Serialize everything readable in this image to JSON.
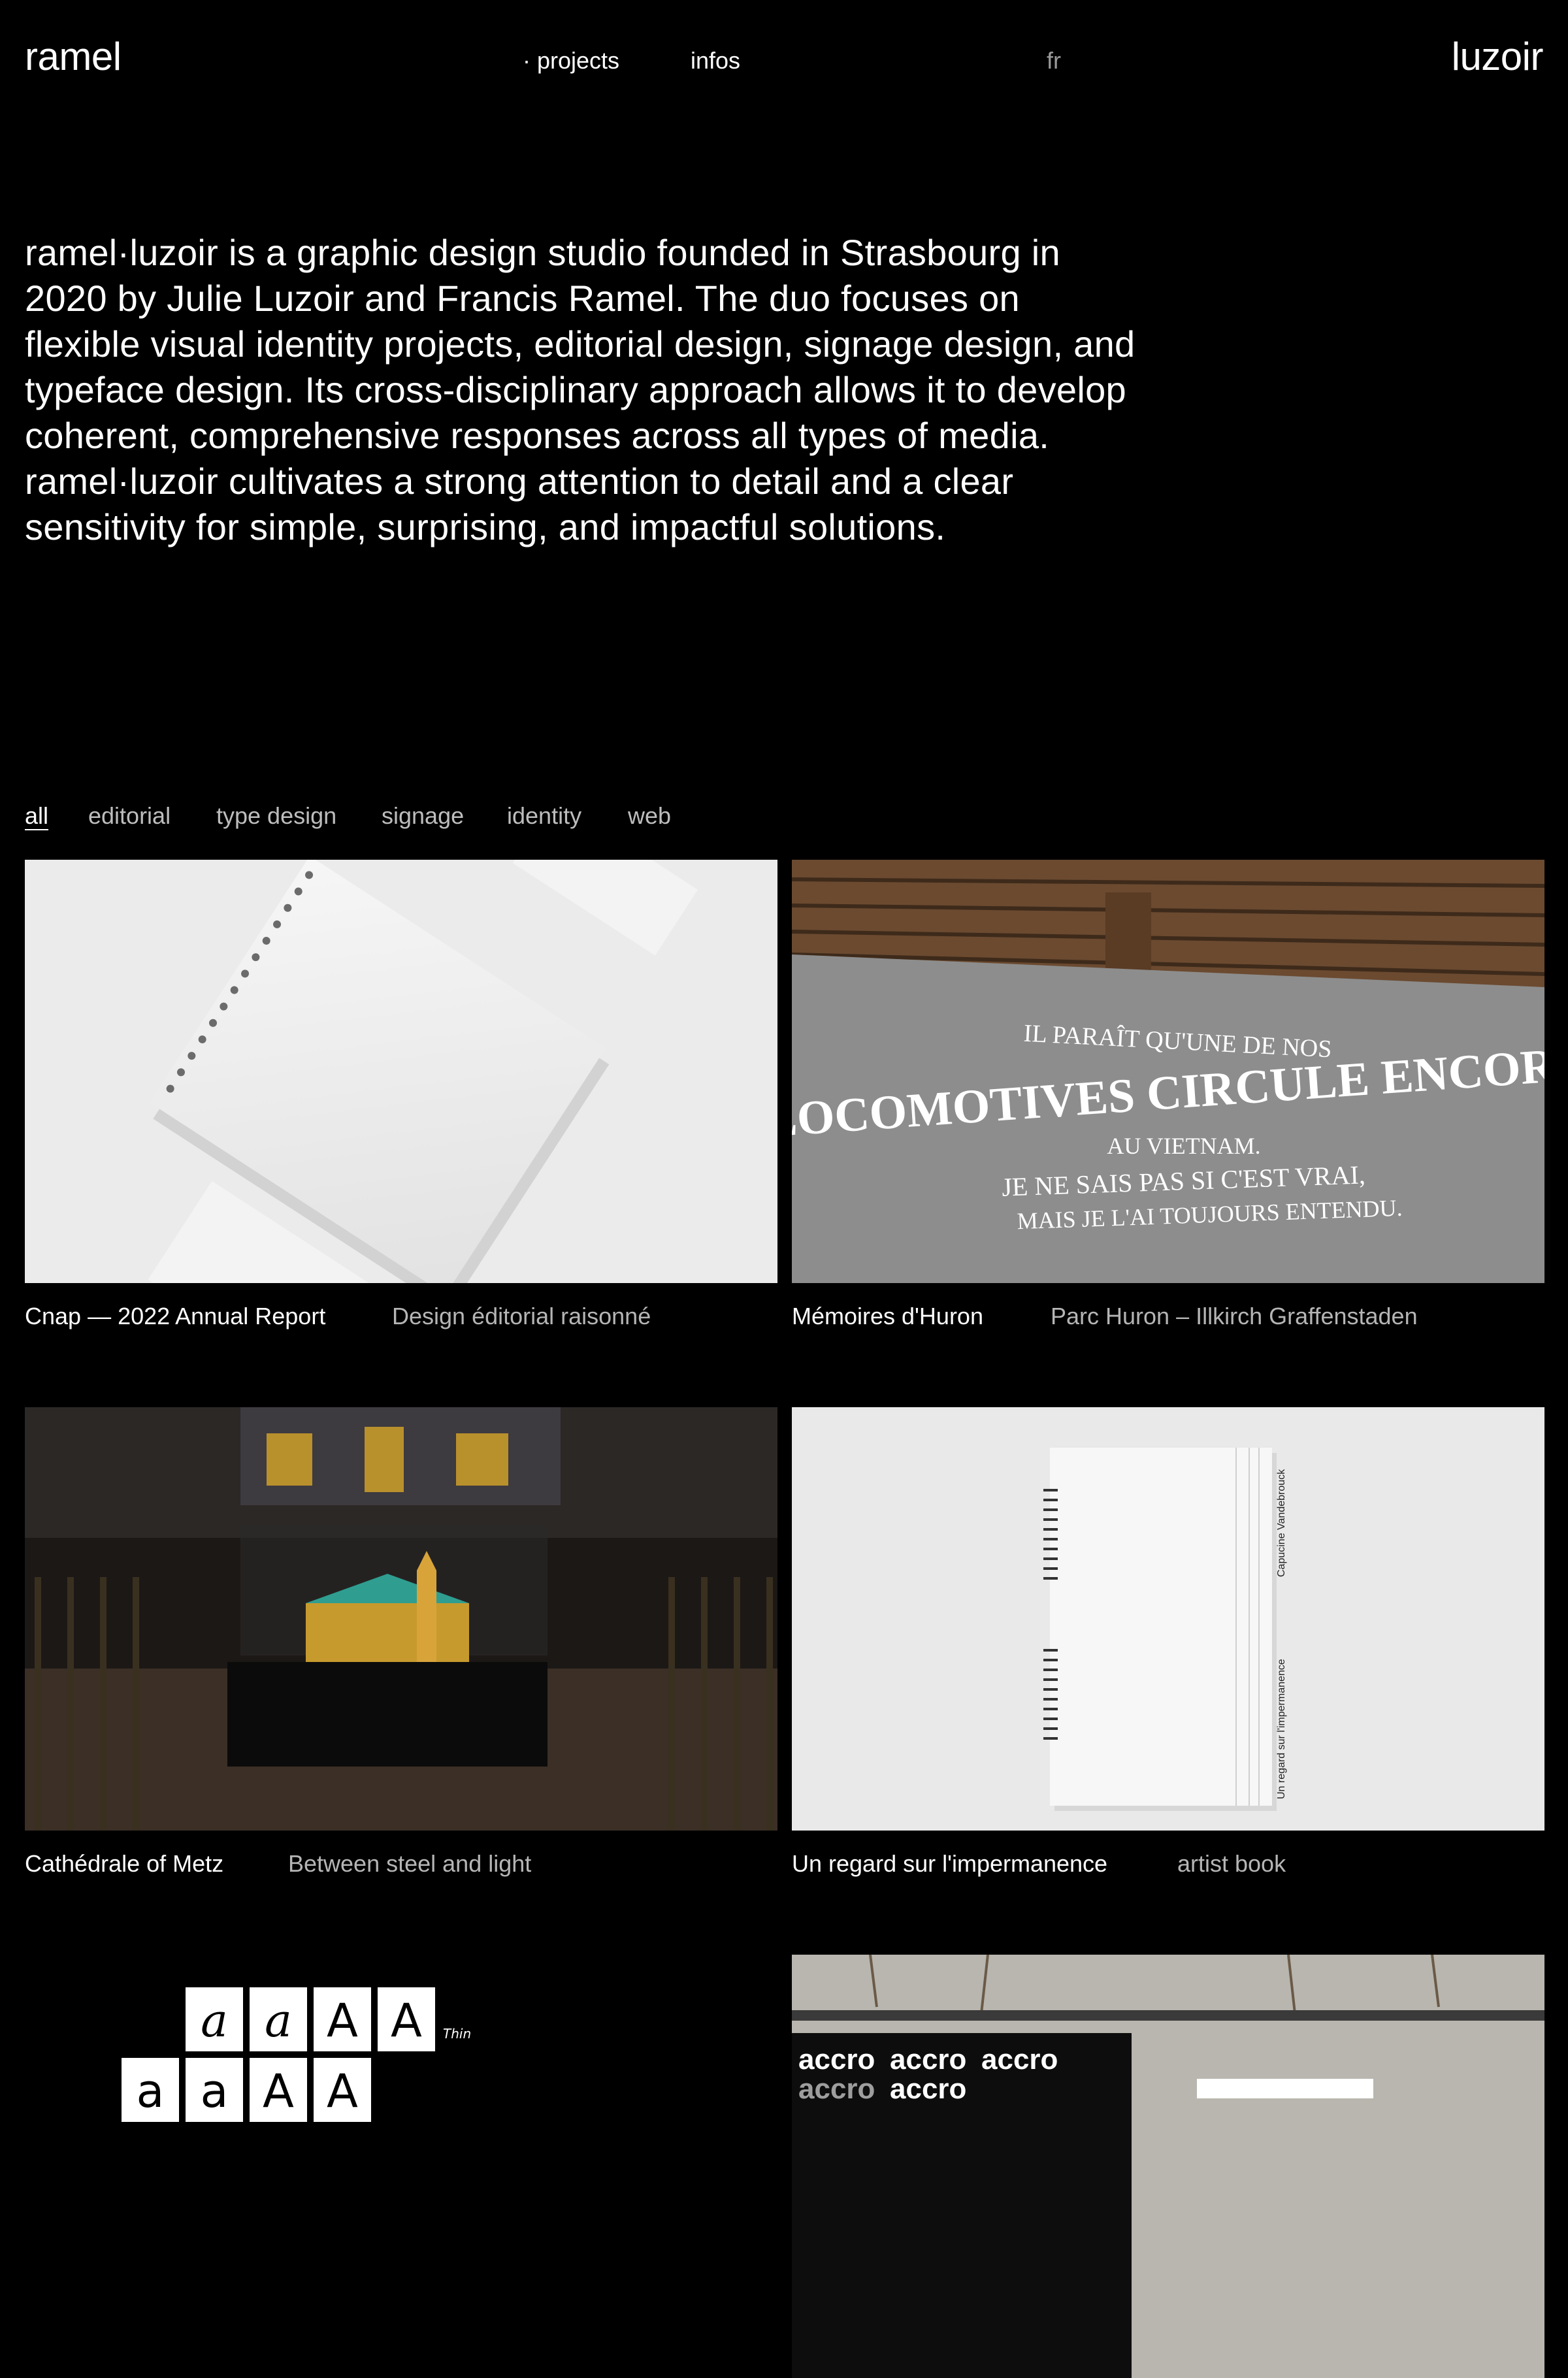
{
  "header": {
    "logo_left": "ramel",
    "logo_right": "luzoir",
    "nav": {
      "projects": "· projects",
      "infos": "infos",
      "lang": "fr"
    }
  },
  "intro": "ramel·luzoir is a graphic design studio founded in Strasbourg in 2020 by Julie Luzoir and Francis Ramel. The duo focuses on flexible visual identity projects, editorial design, signage design, and typeface design. Its cross-disciplinary approach allows it to develop coherent, comprehensive responses across all types of media. ramel·luzoir cultivates a strong attention to detail and a clear sensitivity for simple, surprising, and impactful solutions.",
  "filters": [
    {
      "label": "all",
      "active": true
    },
    {
      "label": "editorial",
      "active": false
    },
    {
      "label": "type design",
      "active": false
    },
    {
      "label": "signage",
      "active": false
    },
    {
      "label": "identity",
      "active": false
    },
    {
      "label": "web",
      "active": false
    }
  ],
  "projects": [
    {
      "title": "Cnap — 2022 Annual Report",
      "subtitle": "Design éditorial raisonné"
    },
    {
      "title": "Mémoires d'Huron",
      "subtitle": "Parc Huron – Illkirch Graffenstaden",
      "image_text": [
        "IL PARAÎT QU'UNE DE NOS",
        "LOCOMOTIVES CIRCULE ENCORE",
        "AU VIETNAM.",
        "JE NE SAIS PAS SI C'EST VRAI,",
        "MAIS JE L'AI TOUJOURS ENTENDU."
      ]
    },
    {
      "title": "Cathédrale of Metz",
      "subtitle": "Between steel and light"
    },
    {
      "title": "Un regard sur l'impermanence",
      "subtitle": "artist book",
      "image_text": [
        "Capucine Vandebrouck",
        "Un regard sur l'impermanence"
      ]
    },
    {
      "title": "",
      "subtitle": "",
      "image_text": [
        "Thin"
      ]
    },
    {
      "title": "",
      "subtitle": "",
      "image_text": [
        "accro"
      ]
    }
  ],
  "colors": {
    "background": "#000000",
    "text": "#ffffff",
    "muted": "#b5b5b5"
  }
}
